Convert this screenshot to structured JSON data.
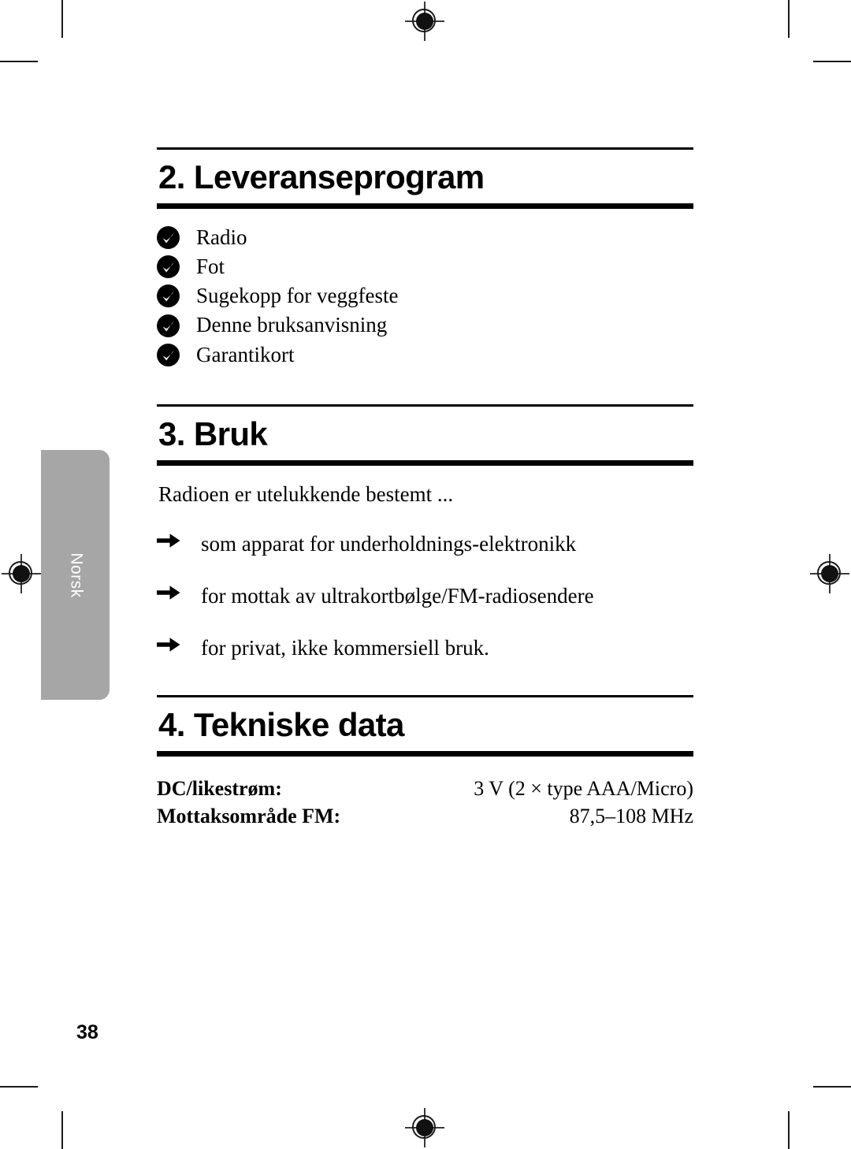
{
  "page": {
    "number": "38",
    "language_tab": "Norsk"
  },
  "sections": [
    {
      "heading": "2. Leveranseprogram",
      "type": "check-list",
      "items": [
        "Radio",
        "Fot",
        "Sugekopp for veggfeste",
        "Denne bruksanvisning",
        "Garantikort"
      ]
    },
    {
      "heading": "3. Bruk",
      "type": "arrow-list",
      "intro": "Radioen er utelukkende bestemt ...",
      "items": [
        "som apparat for underholdnings-elektronikk",
        "for mottak av ultrakortbølge/FM-radiosendere",
        "for privat, ikke kommersiell bruk."
      ]
    },
    {
      "heading": "4. Tekniske data",
      "type": "spec-table",
      "rows": [
        {
          "label": "DC/likestrøm:",
          "value": "3 V (2 × type AAA/Micro)"
        },
        {
          "label": "Mottaksområde FM:",
          "value": "87,5–108 MHz"
        }
      ]
    }
  ],
  "colors": {
    "tab_background": "#a6a6a6",
    "tab_text": "#ffffff",
    "rule": "#000000",
    "text": "#000000"
  }
}
